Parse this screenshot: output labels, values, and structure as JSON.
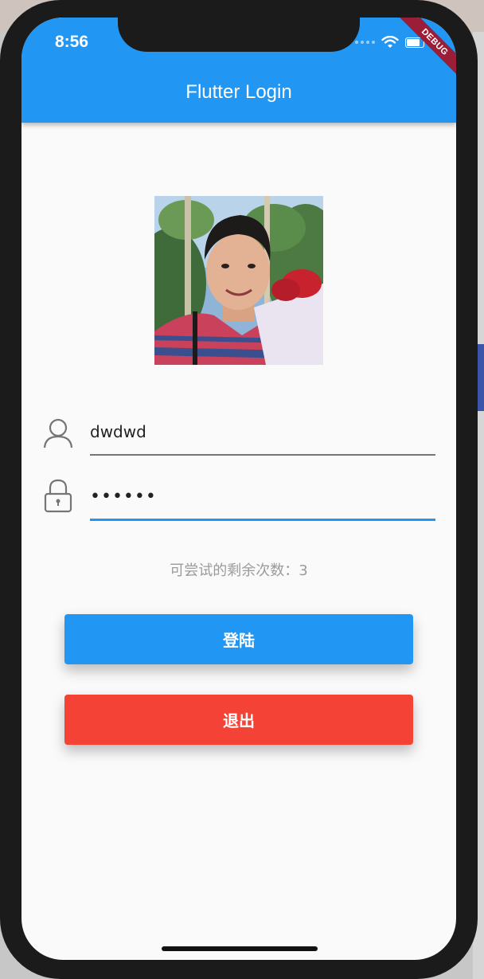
{
  "status_bar": {
    "time": "8:56",
    "debug_label": "DEBUG",
    "icons": [
      "signal-dots-icon",
      "wifi-icon",
      "battery-icon"
    ]
  },
  "app_bar": {
    "title": "Flutter Login",
    "color": "#2196f3"
  },
  "avatar": {
    "icon": "profile-photo"
  },
  "username": {
    "icon": "person-icon",
    "value": "dwdwd"
  },
  "password": {
    "icon": "lock-icon",
    "value": "••••••",
    "focused": true
  },
  "hint": {
    "text": "可尝试的剩余次数：3"
  },
  "buttons": {
    "login_label": "登陆",
    "exit_label": "退出",
    "login_color": "#2196f3",
    "exit_color": "#f44336"
  }
}
